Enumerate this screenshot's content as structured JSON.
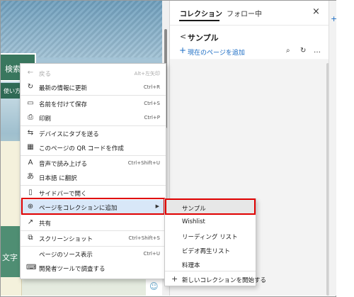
{
  "page": {
    "search_label": "検索",
    "howto_label": "使い方",
    "green_label": "文字",
    "smiley_glyph": "☺"
  },
  "panel": {
    "tab_active": "コレクション",
    "tab_following": "フォロー中",
    "close_glyph": "×",
    "back_glyph": "<",
    "collection_title": "サンプル",
    "add_glyph": "+",
    "add_current_page": "現在のページを追加",
    "search_glyph": "⌕",
    "refresh_glyph": "↻",
    "more_glyph": "…",
    "strip_plus_glyph": "+"
  },
  "context_menu": {
    "items": [
      {
        "label": "戻る",
        "shortcut": "Alt+左矢印",
        "icon": "←",
        "icon_name": "back-arrow-icon",
        "disabled": true
      },
      {
        "label": "最新の情報に更新",
        "shortcut": "Ctrl+R",
        "icon": "↻",
        "icon_name": "refresh-icon"
      },
      {
        "label": "名前を付けて保存",
        "shortcut": "Ctrl+S",
        "icon": "▭",
        "icon_name": "save-icon"
      },
      {
        "label": "印刷",
        "shortcut": "Ctrl+P",
        "icon": "⎙",
        "icon_name": "print-icon"
      },
      {
        "label": "デバイスにタブを送る",
        "shortcut": "",
        "icon": "⇆",
        "icon_name": "send-to-device-icon"
      },
      {
        "label": "このページの QR コードを作成",
        "shortcut": "",
        "icon": "▦",
        "icon_name": "qr-code-icon"
      },
      {
        "label": "音声で読み上げる",
        "shortcut": "Ctrl+Shift+U",
        "icon": "A",
        "icon_name": "read-aloud-icon"
      },
      {
        "label": "日本語 に翻訳",
        "shortcut": "",
        "icon": "あ",
        "icon_name": "translate-icon"
      },
      {
        "label": "サイドバーで開く",
        "shortcut": "",
        "icon": "▯",
        "icon_name": "sidebar-icon"
      },
      {
        "label": "ページをコレクションに追加",
        "shortcut": "",
        "icon": "⊕",
        "icon_name": "add-to-collection-icon",
        "arrow": "▶"
      },
      {
        "label": "共有",
        "shortcut": "",
        "icon": "↗",
        "icon_name": "share-icon"
      },
      {
        "label": "スクリーンショット",
        "shortcut": "Ctrl+Shift+S",
        "icon": "⧉",
        "icon_name": "screenshot-icon"
      },
      {
        "label": "ページのソース表示",
        "shortcut": "Ctrl+U",
        "icon": "",
        "icon_name": ""
      },
      {
        "label": "開発者ツールで調査する",
        "shortcut": "",
        "icon": "⌨",
        "icon_name": "devtools-icon"
      }
    ]
  },
  "submenu": {
    "items": [
      "サンプル",
      "Wishlist",
      "リーディング リスト",
      "ビデオ再生リスト",
      "料理本"
    ],
    "new_collection": "新しいコレクションを開始する",
    "new_glyph": "+"
  },
  "colors": {
    "accent": "#1a6cc4",
    "highlight_red": "#e00000",
    "menu_hover": "#d8e7f8"
  }
}
